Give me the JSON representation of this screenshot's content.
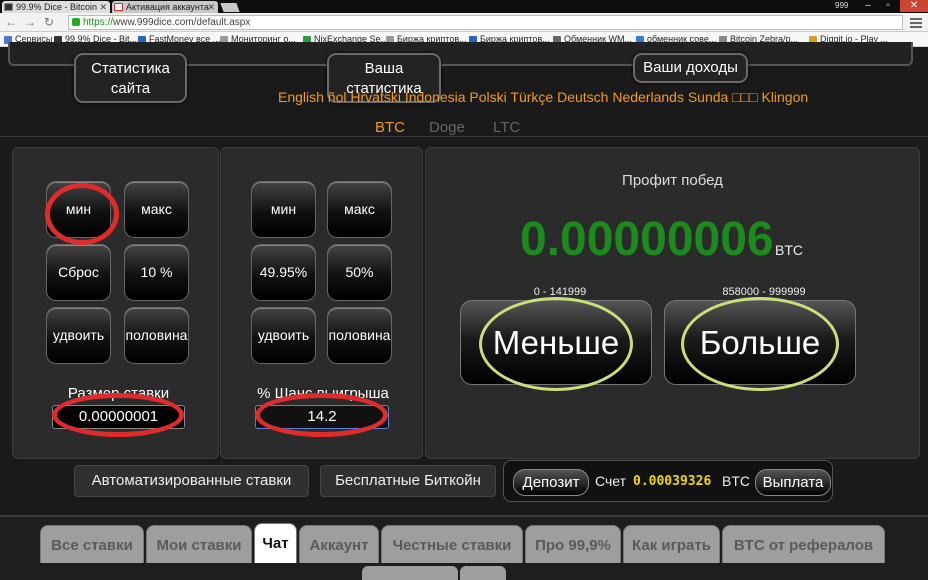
{
  "browser": {
    "tabs": [
      {
        "title": "99.9% Dice - Bitcoin"
      },
      {
        "title": "Активация аккаунта"
      }
    ],
    "win_badge": "999",
    "url_proto": "https://",
    "url_rest": "www.999dice.com/default.aspx",
    "bookmarks": [
      "Сервисы",
      "99.9% Dice - Bit...",
      "FastMoney все ...",
      "Мониторинг о...",
      "NixExchange Se...",
      "Биржа криптов...",
      "Биржа криптов...",
      "Обменник WM...",
      "обменник сове...",
      "Bitcoin Zebra/p...",
      "Diggit.io - Play ..."
    ]
  },
  "nav": {
    "site_stats": "Статистика сайта",
    "your_stats": "Ваша статистика",
    "your_income": "Ваши доходы"
  },
  "languages": "English                                    ñol Hrvatski Indonesia Polski Türkçe Deutsch Nederlands Sunda □□□ Klingon",
  "coins": [
    "BTC",
    "Doge",
    "LTC"
  ],
  "bet_panel": {
    "buttons": [
      "мин",
      "макс",
      "Сброс",
      "10 %",
      "удвоить",
      "половина"
    ],
    "label": "Размер ставки",
    "value": "0.00000001"
  },
  "chance_panel": {
    "buttons": [
      "мин",
      "макс",
      "49.95%",
      "50%",
      "удвоить",
      "половина"
    ],
    "label": "% Шанс выигрыша",
    "value": "14.2"
  },
  "profit": {
    "title": "Профит побед",
    "value": "0.00000006",
    "unit": "BTC",
    "low_range": "0 - 141999",
    "high_range": "858000 - 999999",
    "low_label": "Меньше",
    "high_label": "Больше"
  },
  "actions": {
    "auto_bets": "Автоматизированные ставки",
    "free_btc": "Бесплатные Биткойн",
    "deposit": "Депозит",
    "account_label": "Счет",
    "balance": "0.00039326",
    "balance_unit": "BTC",
    "withdraw": "Выплата"
  },
  "bottom_tabs": [
    "Все ставки",
    "Мои ставки",
    "Чат",
    "Аккаунт",
    "Честные ставки",
    "Про 99,9%",
    "Как играть",
    "BTC от рефералов"
  ],
  "colors": {
    "accent_orange": "#f29a1c",
    "profit_green": "#1d8a1d",
    "balance_yellow": "#f0d800",
    "annotation_red": "#e02b2b",
    "annotation_yellow": "#c9e07a"
  }
}
